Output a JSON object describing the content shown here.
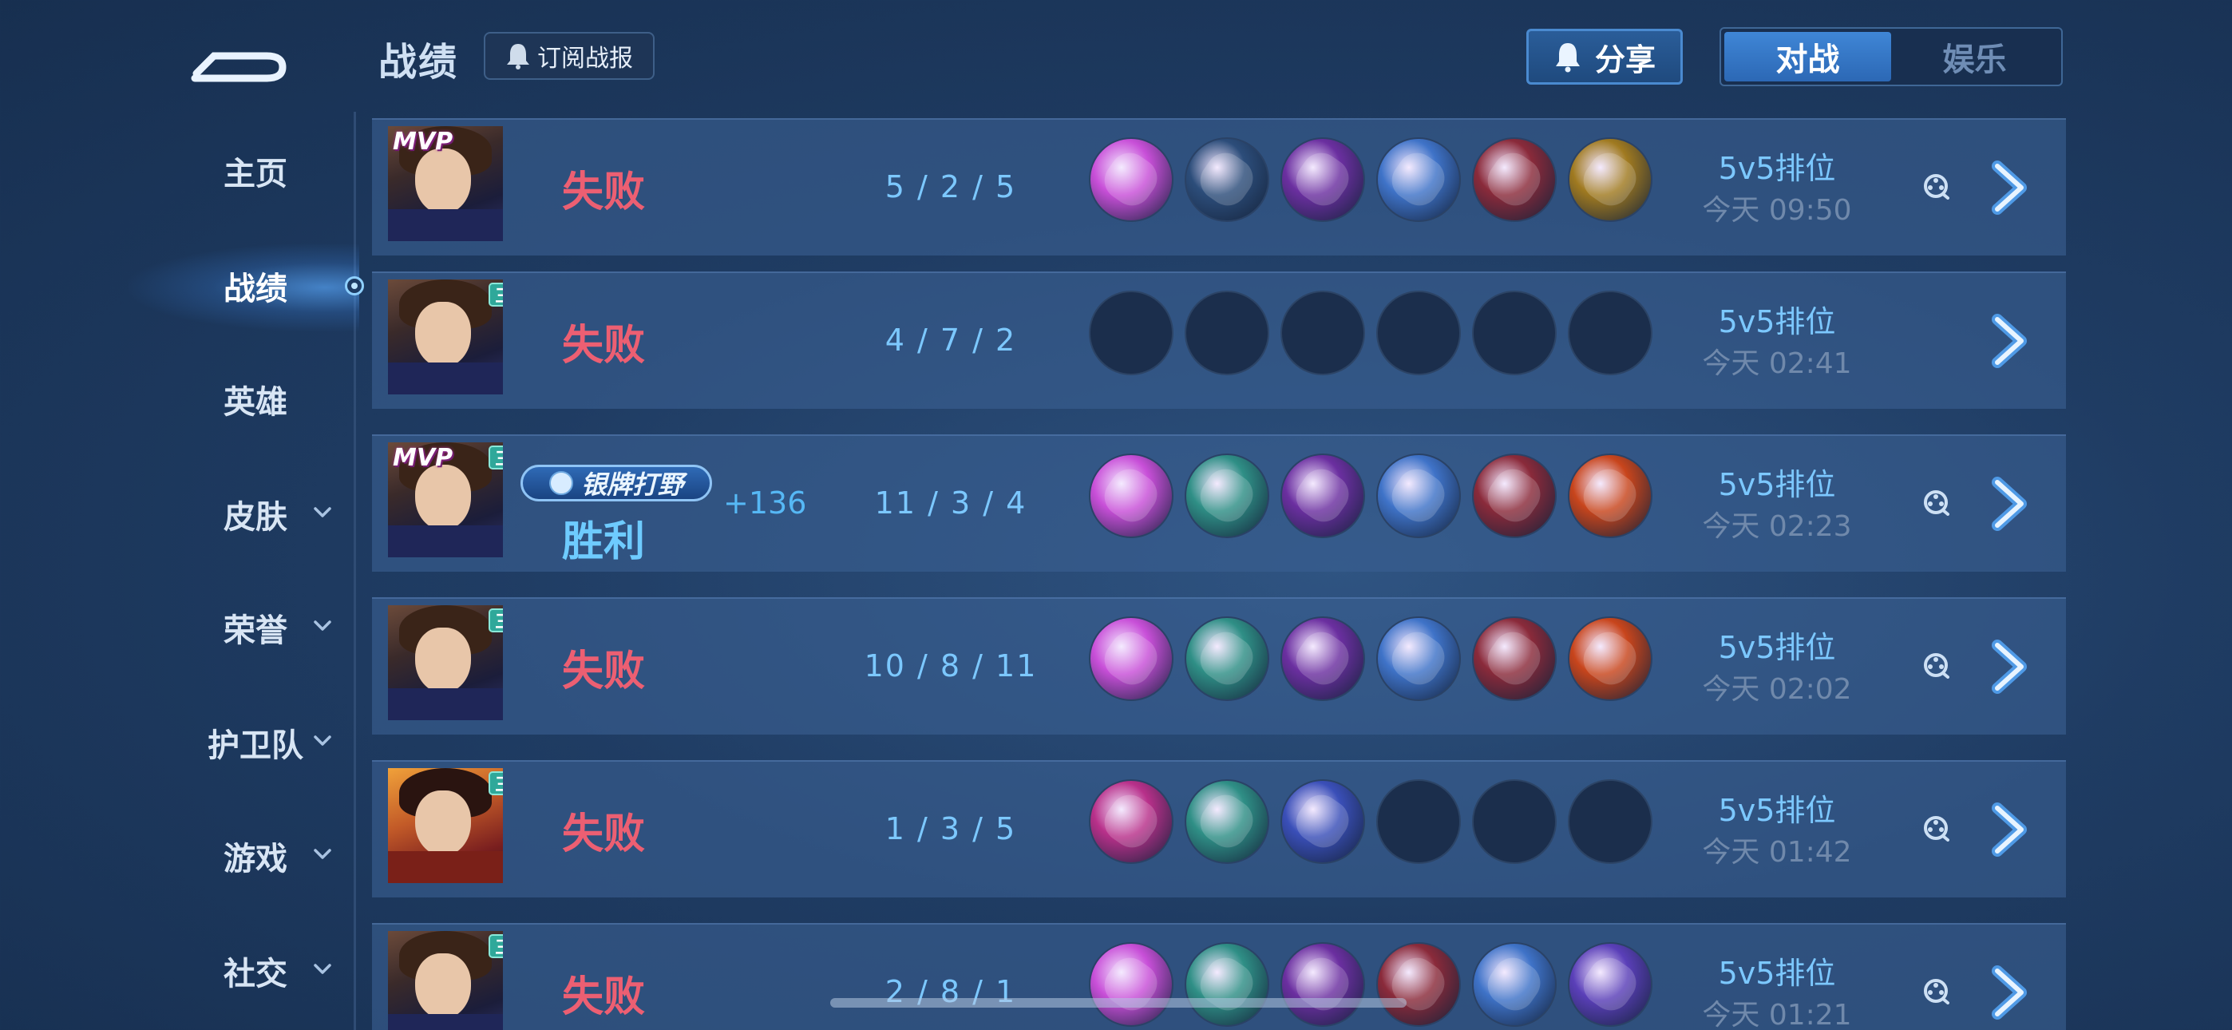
{
  "header": {
    "title": "战绩",
    "subscribe_label": "订阅战报",
    "share_label": "分享",
    "tabs": [
      {
        "label": "对战",
        "active": true
      },
      {
        "label": "娱乐",
        "active": false
      }
    ]
  },
  "sidebar": {
    "items": [
      {
        "label": "主页",
        "has_chevron": false,
        "active": false
      },
      {
        "label": "战绩",
        "has_chevron": false,
        "active": true
      },
      {
        "label": "英雄",
        "has_chevron": false,
        "active": false
      },
      {
        "label": "皮肤",
        "has_chevron": true,
        "active": false
      },
      {
        "label": "荣誉",
        "has_chevron": true,
        "active": false
      },
      {
        "label": "护卫队",
        "has_chevron": true,
        "active": false
      },
      {
        "label": "游戏",
        "has_chevron": true,
        "active": false
      },
      {
        "label": "社交",
        "has_chevron": true,
        "active": false
      }
    ]
  },
  "colors": {
    "lose": "#ec5f72",
    "win": "#6ecbff",
    "accent": "#3f86d6"
  },
  "matches": [
    {
      "mvp_label": "MVP",
      "mode_tag": "",
      "hero": "dark-hair-assassin",
      "result": "失败",
      "outcome": "lose",
      "rank_badge": "",
      "points": "",
      "kda": "5 / 2 / 5",
      "mode": "5v5排位",
      "time": "今天 09:50",
      "has_replay": true,
      "items": [
        "#c84fd8",
        "#2c4d7a",
        "#6b2fa0",
        "#3f73c8",
        "#8a2a3a",
        "#a07a20"
      ]
    },
    {
      "mvp_label": "",
      "mode_tag": "三",
      "hero": "dark-hair-assassin",
      "result": "失败",
      "outcome": "lose",
      "rank_badge": "",
      "points": "",
      "kda": "4 / 7 / 2",
      "mode": "5v5排位",
      "time": "今天 02:41",
      "has_replay": false,
      "items": [
        "",
        "",
        "",
        "",
        "",
        ""
      ]
    },
    {
      "mvp_label": "MVP",
      "mode_tag": "三",
      "hero": "dark-hair-assassin",
      "result": "胜利",
      "outcome": "win",
      "rank_badge": "银牌打野",
      "points": "+136",
      "kda": "11 / 3 / 4",
      "mode": "5v5排位",
      "time": "今天 02:23",
      "has_replay": true,
      "items": [
        "#c84fd8",
        "#2f8f86",
        "#6b2fa0",
        "#3f73c8",
        "#8a2a3a",
        "#c8451c"
      ]
    },
    {
      "mvp_label": "",
      "mode_tag": "三",
      "hero": "dark-hair-assassin",
      "result": "失败",
      "outcome": "lose",
      "rank_badge": "",
      "points": "",
      "kda": "10 / 8 / 11",
      "mode": "5v5排位",
      "time": "今天 02:02",
      "has_replay": true,
      "items": [
        "#c84fd8",
        "#2f8f86",
        "#6b2fa0",
        "#3f73c8",
        "#8a2a3a",
        "#c8451c"
      ]
    },
    {
      "mvp_label": "",
      "mode_tag": "三",
      "hero": "red-warrior",
      "result": "失败",
      "outcome": "lose",
      "rank_badge": "",
      "points": "",
      "kda": "1 / 3 / 5",
      "mode": "5v5排位",
      "time": "今天 01:42",
      "has_replay": true,
      "items": [
        "#b8308a",
        "#2f8f86",
        "#3a4fb8",
        "",
        "",
        ""
      ]
    },
    {
      "mvp_label": "",
      "mode_tag": "三",
      "hero": "dark-hair-assassin",
      "result": "失败",
      "outcome": "lose",
      "rank_badge": "",
      "points": "",
      "kda": "2 / 8 / 1",
      "mode": "5v5排位",
      "time": "今天 01:21",
      "has_replay": true,
      "items": [
        "#c84fd8",
        "#2f8f86",
        "#6b2fa0",
        "#8a2a3a",
        "#3f73c8",
        "#5a3fb8"
      ]
    }
  ]
}
